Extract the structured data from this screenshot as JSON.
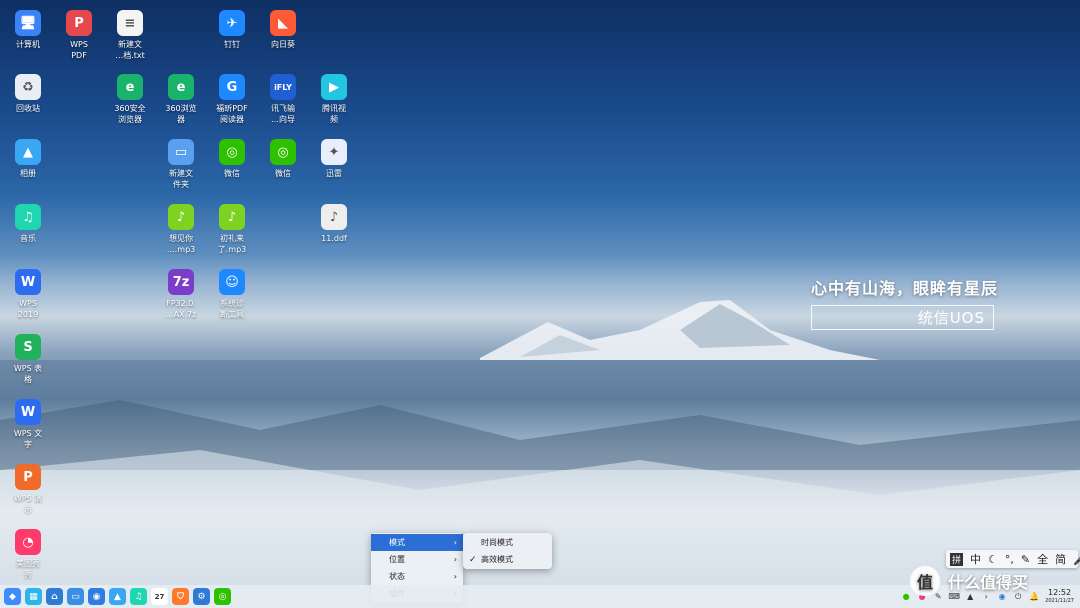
{
  "desktop": {
    "icons": [
      {
        "label": "计算机",
        "glyph": "🖥",
        "color": "#3b82f6"
      },
      {
        "label": "WPS\nPDF",
        "glyph": "P",
        "color": "#e5484d"
      },
      {
        "label": "新建文\n…档.txt",
        "glyph": "≡",
        "color": "#f4f4f4"
      },
      {
        "label": "钉钉",
        "glyph": "✈",
        "color": "#1e88ff"
      },
      {
        "label": "向日葵",
        "glyph": "◣",
        "color": "#ff5a36"
      },
      {
        "label": "回收站",
        "glyph": "♻",
        "color": "#e8eef4"
      },
      {
        "label": "360安全\n浏览器",
        "glyph": "e",
        "color": "#19b36b"
      },
      {
        "label": "360浏览\n器",
        "glyph": "e",
        "color": "#19b36b"
      },
      {
        "label": "福昕PDF\n阅读器",
        "glyph": "G",
        "color": "#1e88ff"
      },
      {
        "label": "讯飞输\n…向导",
        "glyph": "iFLY",
        "color": "#1f5fd1"
      },
      {
        "label": "腾讯视\n频",
        "glyph": "▶",
        "color": "#23c6e0"
      },
      {
        "label": "相册",
        "glyph": "▲",
        "color": "#3aa7f5"
      },
      {
        "label": "新建文\n件夹",
        "glyph": "▭",
        "color": "#5aa0ef"
      },
      {
        "label": "微信",
        "glyph": "◎",
        "color": "#2dc100"
      },
      {
        "label": "微信",
        "glyph": "◎",
        "color": "#2dc100"
      },
      {
        "label": "迅雷",
        "glyph": "✦",
        "color": "#e8eefc"
      },
      {
        "label": "音乐",
        "glyph": "♫",
        "color": "#1ed6b0"
      },
      {
        "label": "想见你\n….mp3",
        "glyph": "♪",
        "color": "#7ed321"
      },
      {
        "label": "初礼来\n了.mp3",
        "glyph": "♪",
        "color": "#7ed321"
      },
      {
        "label": "11.ddf",
        "glyph": "♪",
        "color": "#eeeeee"
      },
      {
        "label": "WPS\n2019",
        "glyph": "W",
        "color": "#2d6cf0"
      },
      {
        "label": "FP32.0.\n…AX.7z",
        "glyph": "7z",
        "color": "#7a3cc9"
      },
      {
        "label": "系统诊\n断工具",
        "glyph": "☺",
        "color": "#1e88ff"
      },
      {
        "label": "WPS 表\n格",
        "glyph": "S",
        "color": "#21b15a"
      },
      {
        "label": "WPS 文\n字",
        "glyph": "W",
        "color": "#2d6cf0"
      },
      {
        "label": "WPS 演\n示",
        "glyph": "P",
        "color": "#f06a2a"
      },
      {
        "label": "美图秀\n秀",
        "glyph": "◔",
        "color": "#ff3b6b"
      }
    ],
    "slogan": "心中有山海，眼眸有星辰",
    "brand": "统信UOS"
  },
  "context_menu": {
    "items": [
      {
        "label": "模式",
        "active": true
      },
      {
        "label": "位置",
        "active": false
      },
      {
        "label": "状态",
        "active": false
      },
      {
        "label": "插件",
        "active": false
      }
    ],
    "submenu": [
      {
        "label": "时尚模式",
        "checked": false
      },
      {
        "label": "高效模式",
        "checked": true
      }
    ]
  },
  "ime": {
    "items": [
      "拼",
      "中",
      "☾",
      "°,",
      "✎",
      "全",
      "简",
      "🎤"
    ]
  },
  "dock": {
    "apps": [
      {
        "name": "launcher-icon",
        "glyph": "◆",
        "color": "#3d8bfd"
      },
      {
        "name": "multitask-icon",
        "glyph": "▦",
        "color": "#2bb5e8"
      },
      {
        "name": "home-icon",
        "glyph": "⌂",
        "color": "#2e7bd6"
      },
      {
        "name": "file-manager-icon",
        "glyph": "▭",
        "color": "#3a8ee6"
      },
      {
        "name": "browser-icon",
        "glyph": "◉",
        "color": "#2f7de1"
      },
      {
        "name": "photos-icon",
        "glyph": "▲",
        "color": "#3aa7f5"
      },
      {
        "name": "music-icon",
        "glyph": "♫",
        "color": "#1ed6b0"
      },
      {
        "name": "calendar-icon",
        "glyph": "27",
        "color": "#ffffff"
      },
      {
        "name": "app-store-icon",
        "glyph": "⛉",
        "color": "#ff7a2f"
      },
      {
        "name": "settings-icon",
        "glyph": "⚙",
        "color": "#2e7bd6"
      },
      {
        "name": "wechat-icon",
        "glyph": "◎",
        "color": "#2dc100"
      }
    ],
    "clock_time": "12:52",
    "clock_date": "2021/11/27"
  },
  "watermark": {
    "badge": "值",
    "text": "什么值得买"
  }
}
